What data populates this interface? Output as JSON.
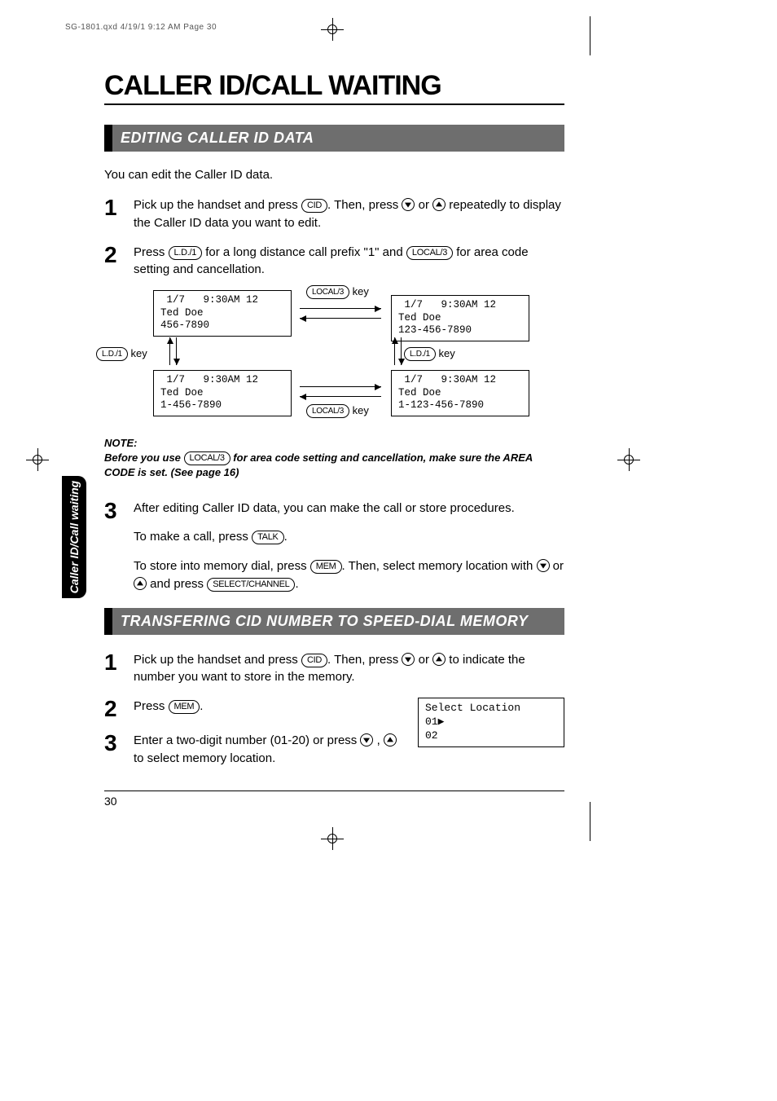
{
  "prepress_header": "SG-1801.qxd  4/19/1 9:12 AM  Page 30",
  "chapter_title": "CALLER ID/CALL WAITING",
  "side_tab": "Caller ID/Call waiting",
  "page_number": "30",
  "section1": {
    "title": "EDITING CALLER ID DATA",
    "intro": "You can edit the Caller ID data.",
    "step1_a": "Pick up the handset and press ",
    "step1_b": ". Then, press ",
    "step1_c": " or ",
    "step1_d": " repeatedly to display the Caller ID data you want to edit.",
    "step2_a": "Press ",
    "step2_b": " for a long distance call prefix \"1\" and ",
    "step2_c": " for area code setting and cancellation.",
    "note_label": "NOTE:",
    "note_a": "Before you use ",
    "note_b": " for area code setting and cancellation, make sure the AREA CODE is set. (See page 16)",
    "step3_a": "After editing Caller ID data, you can make the call or store procedures.",
    "step3_b1": "To make a call, press ",
    "step3_b2": ".",
    "step3_c1": "To store into memory dial, press ",
    "step3_c2": ". Then, select memory location with ",
    "step3_c3": " or ",
    "step3_c4": " and press ",
    "step3_c5": "."
  },
  "section2": {
    "title": "TRANSFERING CID NUMBER TO SPEED-DIAL MEMORY",
    "step1_a": "Pick up the handset and press ",
    "step1_b": ". Then, press ",
    "step1_c": " or ",
    "step1_d": " to indicate the number you want to store in the memory.",
    "step2_a": "Press ",
    "step2_b": ".",
    "step3_a": "Enter a two-digit number (01-20) or press ",
    "step3_b": " , ",
    "step3_c": " to select memory location."
  },
  "keys": {
    "cid": "CID",
    "ld1": "L.D./1",
    "local3": "LOCAL/3",
    "talk": "TALK",
    "mem": "MEM",
    "select": "SELECT/CHANNEL"
  },
  "diagram": {
    "lcd1": " 1/7   9:30AM 12\nTed Doe\n456-7890",
    "lcd2": " 1/7   9:30AM 12\nTed Doe\n123-456-7890",
    "lcd3": " 1/7   9:30AM 12\nTed Doe\n1-456-7890",
    "lcd4": " 1/7   9:30AM 12\nTed Doe\n1-123-456-7890",
    "key_label": " key"
  },
  "memlcd": "Select Location\n01▶\n02"
}
